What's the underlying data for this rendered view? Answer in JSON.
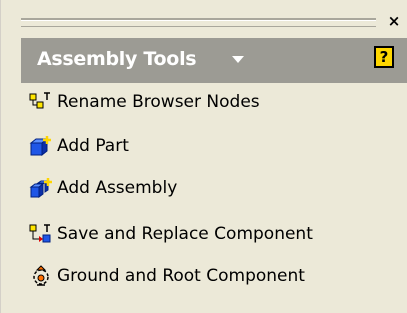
{
  "panel": {
    "close_label": "×",
    "header": {
      "title": "Assembly Tools",
      "help_label": "?"
    },
    "items": [
      {
        "label": "Rename Browser Nodes",
        "icon": "rename-nodes-icon"
      },
      {
        "label": "Add Part",
        "icon": "add-part-icon"
      },
      {
        "label": "Add Assembly",
        "icon": "add-assembly-icon"
      },
      {
        "label": "Save and Replace Component",
        "icon": "save-replace-icon"
      },
      {
        "label": "Ground and Root Component",
        "icon": "ground-root-icon"
      }
    ]
  },
  "colors": {
    "background": "#ece9d8",
    "header": "#9c9b94",
    "help_badge": "#ffd700"
  }
}
